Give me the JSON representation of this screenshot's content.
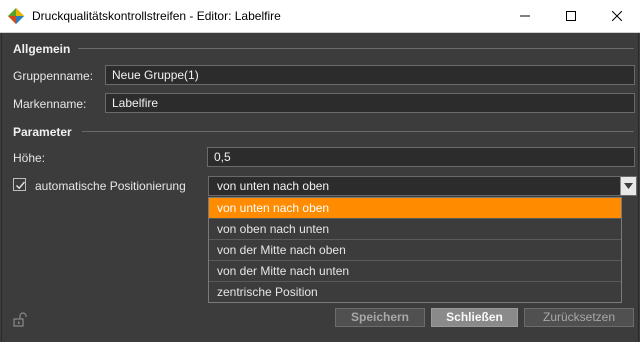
{
  "window": {
    "title": "Druckqualitätskontrollstreifen - Editor: Labelfire",
    "minimize_glyph": "—",
    "maximize_glyph": "☐",
    "close_glyph": "✕"
  },
  "sections": {
    "general": "Allgemein",
    "parameters": "Parameter"
  },
  "fields": {
    "group_label": "Gruppenname:",
    "group_value": "Neue Gruppe(1)",
    "mark_label": "Markenname:",
    "mark_value": "Labelfire",
    "height_label": "Höhe:",
    "height_value": "0,5"
  },
  "auto_position": {
    "checked": true,
    "label": "automatische Positionierung",
    "selected": "von unten nach oben",
    "options": [
      "von unten nach oben",
      "von oben nach unten",
      "von der Mitte nach oben",
      "von der Mitte nach unten",
      "zentrische Position"
    ]
  },
  "buttons": {
    "save": "Speichern",
    "close": "Schließen",
    "reset": "Zurücksetzen"
  },
  "colors": {
    "accent": "#ff8c00",
    "background": "#3c3c3c"
  },
  "icons": {
    "app": "app-logo-icon",
    "lock": "unlock-icon",
    "dropdown": "chevron-down-icon",
    "check": "check-icon"
  }
}
